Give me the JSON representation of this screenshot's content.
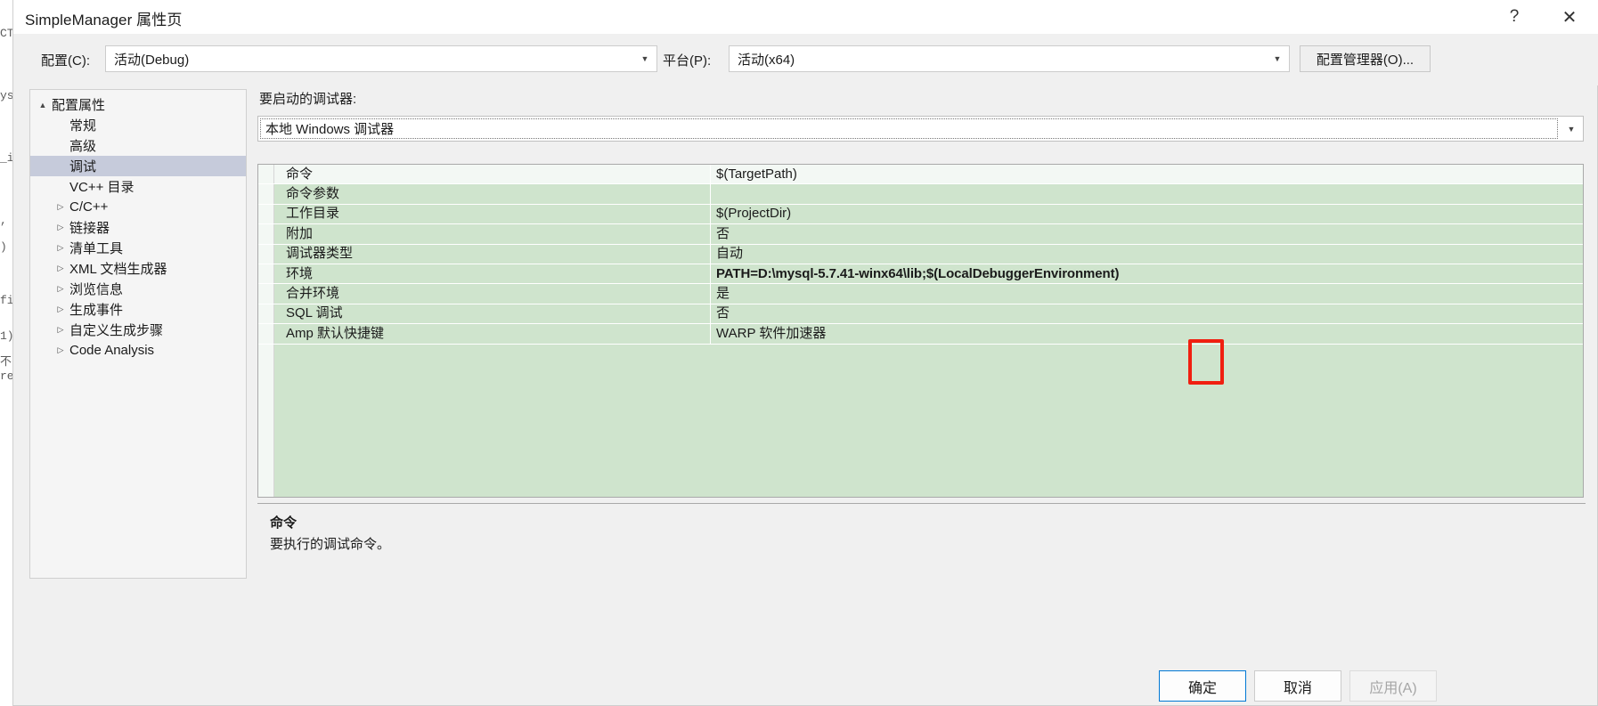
{
  "window": {
    "title": "SimpleManager 属性页",
    "help_icon": "?",
    "close_icon": "✕"
  },
  "config_bar": {
    "configuration_label": "配置(C):",
    "configuration_value": "活动(Debug)",
    "platform_label": "平台(P):",
    "platform_value": "活动(x64)",
    "config_manager_button": "配置管理器(O)..."
  },
  "tree": {
    "items": [
      {
        "label": "配置属性",
        "level": 1,
        "expander": "▲",
        "selected": false
      },
      {
        "label": "常规",
        "level": 2,
        "expander": "",
        "selected": false
      },
      {
        "label": "高级",
        "level": 2,
        "expander": "",
        "selected": false
      },
      {
        "label": "调试",
        "level": 2,
        "expander": "",
        "selected": true
      },
      {
        "label": "VC++ 目录",
        "level": 2,
        "expander": "",
        "selected": false
      },
      {
        "label": "C/C++",
        "level": 2,
        "expander": "▷",
        "selected": false
      },
      {
        "label": "链接器",
        "level": 2,
        "expander": "▷",
        "selected": false
      },
      {
        "label": "清单工具",
        "level": 2,
        "expander": "▷",
        "selected": false
      },
      {
        "label": "XML 文档生成器",
        "level": 2,
        "expander": "▷",
        "selected": false
      },
      {
        "label": "浏览信息",
        "level": 2,
        "expander": "▷",
        "selected": false
      },
      {
        "label": "生成事件",
        "level": 2,
        "expander": "▷",
        "selected": false
      },
      {
        "label": "自定义生成步骤",
        "level": 2,
        "expander": "▷",
        "selected": false
      },
      {
        "label": "Code Analysis",
        "level": 2,
        "expander": "▷",
        "selected": false
      }
    ]
  },
  "pane": {
    "launcher_label": "要启动的调试器:",
    "launcher_value": "本地 Windows 调试器"
  },
  "grid": {
    "rows": [
      {
        "name": "命令",
        "value": "$(TargetPath)",
        "bold": false,
        "selected": true
      },
      {
        "name": "命令参数",
        "value": "",
        "bold": false,
        "selected": false
      },
      {
        "name": "工作目录",
        "value": "$(ProjectDir)",
        "bold": false,
        "selected": false
      },
      {
        "name": "附加",
        "value": "否",
        "bold": false,
        "selected": false
      },
      {
        "name": "调试器类型",
        "value": "自动",
        "bold": false,
        "selected": false
      },
      {
        "name": "环境",
        "value": "PATH=D:\\mysql-5.7.41-winx64\\lib;$(LocalDebuggerEnvironment)",
        "bold": true,
        "selected": false
      },
      {
        "name": "合并环境",
        "value": "是",
        "bold": false,
        "selected": false
      },
      {
        "name": "SQL 调试",
        "value": "否",
        "bold": false,
        "selected": false
      },
      {
        "name": "Amp 默认快捷键",
        "value": "WARP 软件加速器",
        "bold": false,
        "selected": false
      }
    ]
  },
  "description": {
    "title": "命令",
    "body": "要执行的调试命令。"
  },
  "footer": {
    "ok": "确定",
    "cancel": "取消",
    "apply": "应用(A)"
  },
  "annotation": {
    "shape": "rectangle",
    "color": "#f01f10"
  },
  "editor_background": {
    "lines": [
      "CT_",
      "ys",
      "_i",
      ",",
      ")",
      "fi",
      "1)",
      "不",
      "res"
    ]
  }
}
